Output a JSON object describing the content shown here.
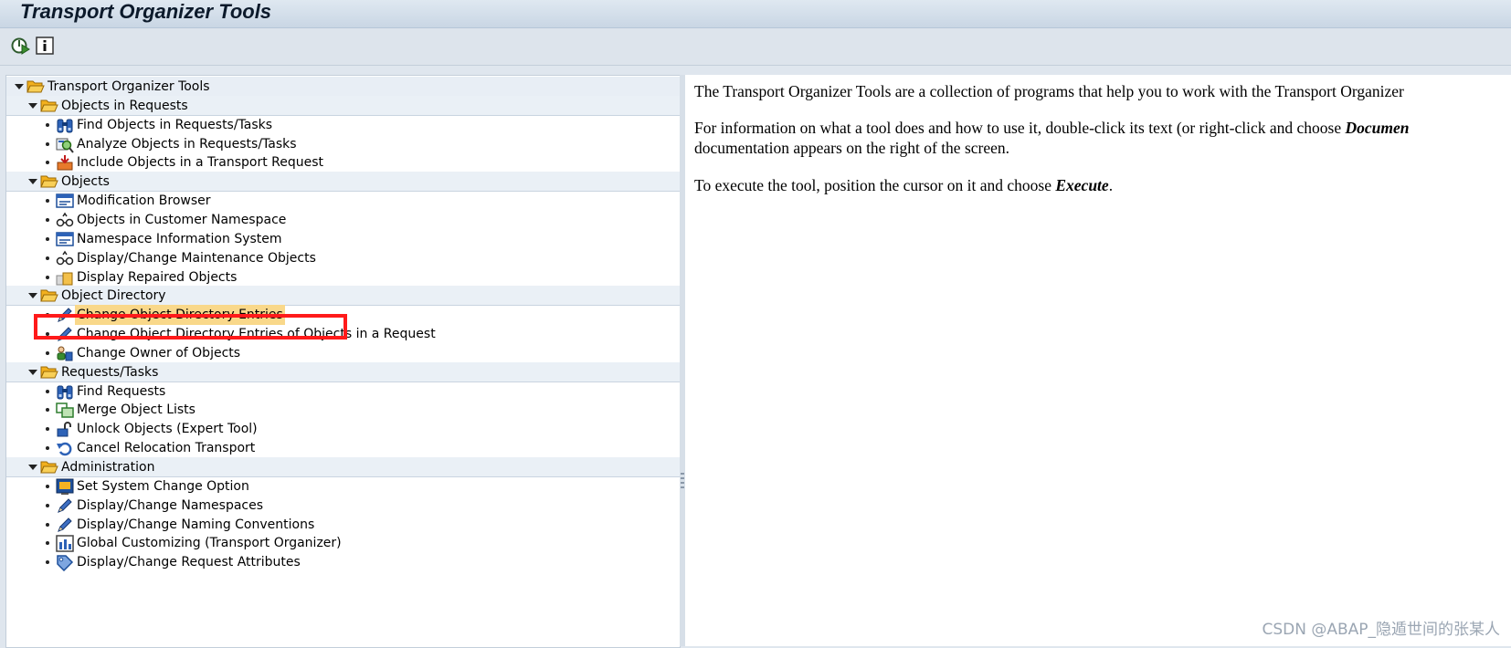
{
  "window": {
    "title": "Transport Organizer Tools"
  },
  "toolbar": {
    "execute_icon": "execute-icon",
    "info_icon": "info-icon"
  },
  "tree": {
    "root": {
      "label": "Transport Organizer Tools",
      "icon": "folder-open-icon"
    },
    "groups": [
      {
        "label": "Objects in Requests",
        "icon": "folder-open-icon",
        "items": [
          {
            "label": "Find Objects in Requests/Tasks",
            "icon": "binoculars-icon"
          },
          {
            "label": "Analyze Objects in Requests/Tasks",
            "icon": "analyze-icon"
          },
          {
            "label": "Include Objects in a Transport Request",
            "icon": "include-icon"
          }
        ]
      },
      {
        "label": "Objects",
        "icon": "folder-open-icon",
        "items": [
          {
            "label": "Modification Browser",
            "icon": "browser-icon"
          },
          {
            "label": "Objects in Customer Namespace",
            "icon": "objects-icon"
          },
          {
            "label": "Namespace Information System",
            "icon": "browser-icon"
          },
          {
            "label": "Display/Change Maintenance Objects",
            "icon": "objects-icon"
          },
          {
            "label": "Display Repaired Objects",
            "icon": "repaired-icon"
          }
        ]
      },
      {
        "label": "Object Directory",
        "icon": "folder-open-icon",
        "items": [
          {
            "label": "Change Object Directory Entries",
            "icon": "pencil-icon",
            "selected": true
          },
          {
            "label": "Change Object Directory Entries of Objects in a Request",
            "icon": "pencil-icon"
          },
          {
            "label": "Change Owner of Objects",
            "icon": "owner-icon"
          }
        ]
      },
      {
        "label": "Requests/Tasks",
        "icon": "folder-open-icon",
        "items": [
          {
            "label": "Find Requests",
            "icon": "binoculars-icon"
          },
          {
            "label": "Merge Object Lists",
            "icon": "merge-icon"
          },
          {
            "label": "Unlock Objects (Expert Tool)",
            "icon": "unlock-icon"
          },
          {
            "label": "Cancel Relocation Transport",
            "icon": "undo-icon"
          }
        ]
      },
      {
        "label": "Administration",
        "icon": "folder-open-icon",
        "items": [
          {
            "label": "Set System Change Option",
            "icon": "system-icon"
          },
          {
            "label": "Display/Change Namespaces",
            "icon": "pencil-icon"
          },
          {
            "label": "Display/Change Naming Conventions",
            "icon": "pencil-icon"
          },
          {
            "label": "Global Customizing (Transport Organizer)",
            "icon": "table-icon"
          },
          {
            "label": "Display/Change Request Attributes",
            "icon": "attributes-icon"
          }
        ]
      }
    ]
  },
  "doc": {
    "p1": "The Transport Organizer Tools are a collection of programs that help you to work with the Transport Organizer",
    "p2a": "For information on what a tool does and how to use it, double-click its text (or right-click and choose ",
    "p2b": "Documen",
    "p2c": "documentation appears on the right of the screen.",
    "p3a": "To execute the tool, position the cursor on it and choose ",
    "p3b": "Execute",
    "p3c": "."
  },
  "watermark": "CSDN @ABAP_隐遁世间的张某人",
  "colors": {
    "selection": "#f9d88a",
    "highlight_box": "#ff1a1a",
    "folder": "#f5b324"
  }
}
